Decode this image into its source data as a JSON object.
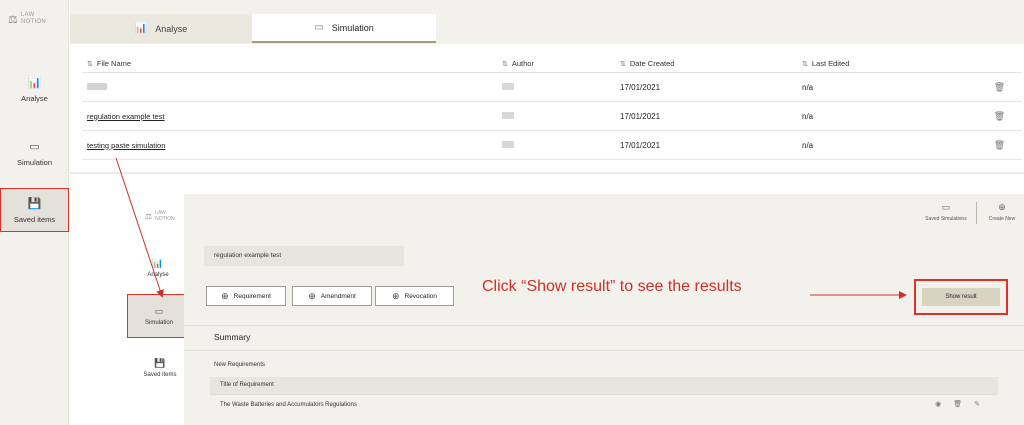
{
  "logo": {
    "line1": "LAW",
    "line2": "NOTION"
  },
  "sidebar": {
    "items": [
      {
        "label": "Analyse"
      },
      {
        "label": "Simulation"
      },
      {
        "label": "Saved items"
      }
    ]
  },
  "tabs": [
    {
      "label": "Analyse"
    },
    {
      "label": "Simulation"
    }
  ],
  "table": {
    "headers": [
      "File Name",
      "Author",
      "Date Created",
      "Last Edited"
    ],
    "rows": [
      {
        "name": "",
        "date": "17/01/2021",
        "edited": "n/a"
      },
      {
        "name": "regulation example test",
        "date": "17/01/2021",
        "edited": "n/a"
      },
      {
        "name": "testing paste simulation",
        "date": "17/01/2021",
        "edited": "n/a"
      }
    ]
  },
  "inset": {
    "logo": {
      "line1": "LAW",
      "line2": "NOTION"
    },
    "sidebar": {
      "items": [
        {
          "label": "Analyse"
        },
        {
          "label": "Simulation"
        },
        {
          "label": "Saved items"
        }
      ]
    },
    "top": {
      "saved_simulations": "Saved Simulations",
      "create_new": "Create New"
    },
    "simulation_name": "regulation example test",
    "buttons": {
      "requirement": "Requirement",
      "amendment": "Amendment",
      "revocation": "Revocation"
    },
    "show_result": "Show result",
    "summary": "Summary",
    "new_requirements": "New Requirements",
    "req_header": "Title of Requirement",
    "req_rows": [
      "The Waste Batteries and Accumulators Regulations"
    ]
  },
  "annotation": {
    "callout": "Click “Show result” to see the results"
  },
  "colors": {
    "accent": "#e0302a",
    "background": "#f2f1ec",
    "tab_underline": "#a89a72"
  }
}
